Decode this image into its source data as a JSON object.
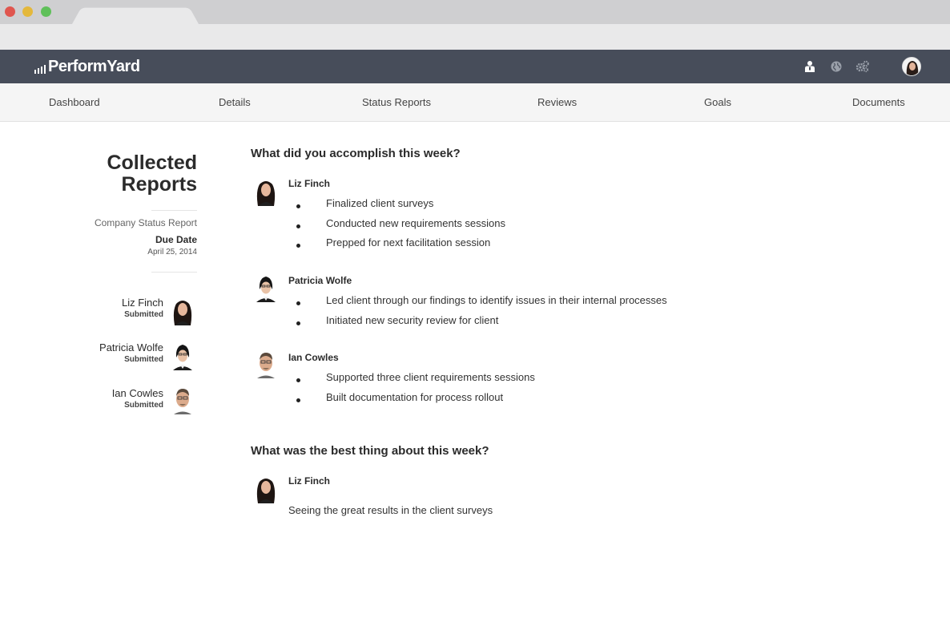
{
  "app": {
    "logo_text": "PerformYard"
  },
  "nav": {
    "items": [
      {
        "label": "Dashboard"
      },
      {
        "label": "Details"
      },
      {
        "label": "Status Reports"
      },
      {
        "label": "Reviews"
      },
      {
        "label": "Goals"
      },
      {
        "label": "Documents"
      }
    ]
  },
  "header_icons": [
    "person-badge-icon",
    "globe-icon",
    "gears-icon",
    "user-avatar"
  ],
  "sidebar": {
    "title_line1": "Collected",
    "title_line2": "Reports",
    "report_name": "Company Status Report",
    "due_label": "Due Date",
    "due_date": "April 25, 2014",
    "people": [
      {
        "name": "Liz Finch",
        "status": "Submitted"
      },
      {
        "name": "Patricia Wolfe",
        "status": "Submitted"
      },
      {
        "name": "Ian Cowles",
        "status": "Submitted"
      }
    ]
  },
  "main": {
    "question1": "What did you accomplish this week?",
    "responses1": [
      {
        "name": "Liz Finch",
        "items": [
          "Finalized client surveys",
          "Conducted new requirements sessions",
          "Prepped for next facilitation session"
        ]
      },
      {
        "name": "Patricia Wolfe",
        "items": [
          "Led client through our findings to identify issues in their internal processes",
          "Initiated new security review for client"
        ]
      },
      {
        "name": "Ian Cowles",
        "items": [
          "Supported three client requirements sessions",
          "Built documentation for process rollout"
        ]
      }
    ],
    "question2": "What was the best thing about this week?",
    "response2": {
      "name": "Liz Finch",
      "text": "Seeing the great results in the client surveys"
    }
  },
  "colors": {
    "header_bg": "#474d5a",
    "nav_bg": "#f5f5f5",
    "text": "#2b2b2b"
  }
}
